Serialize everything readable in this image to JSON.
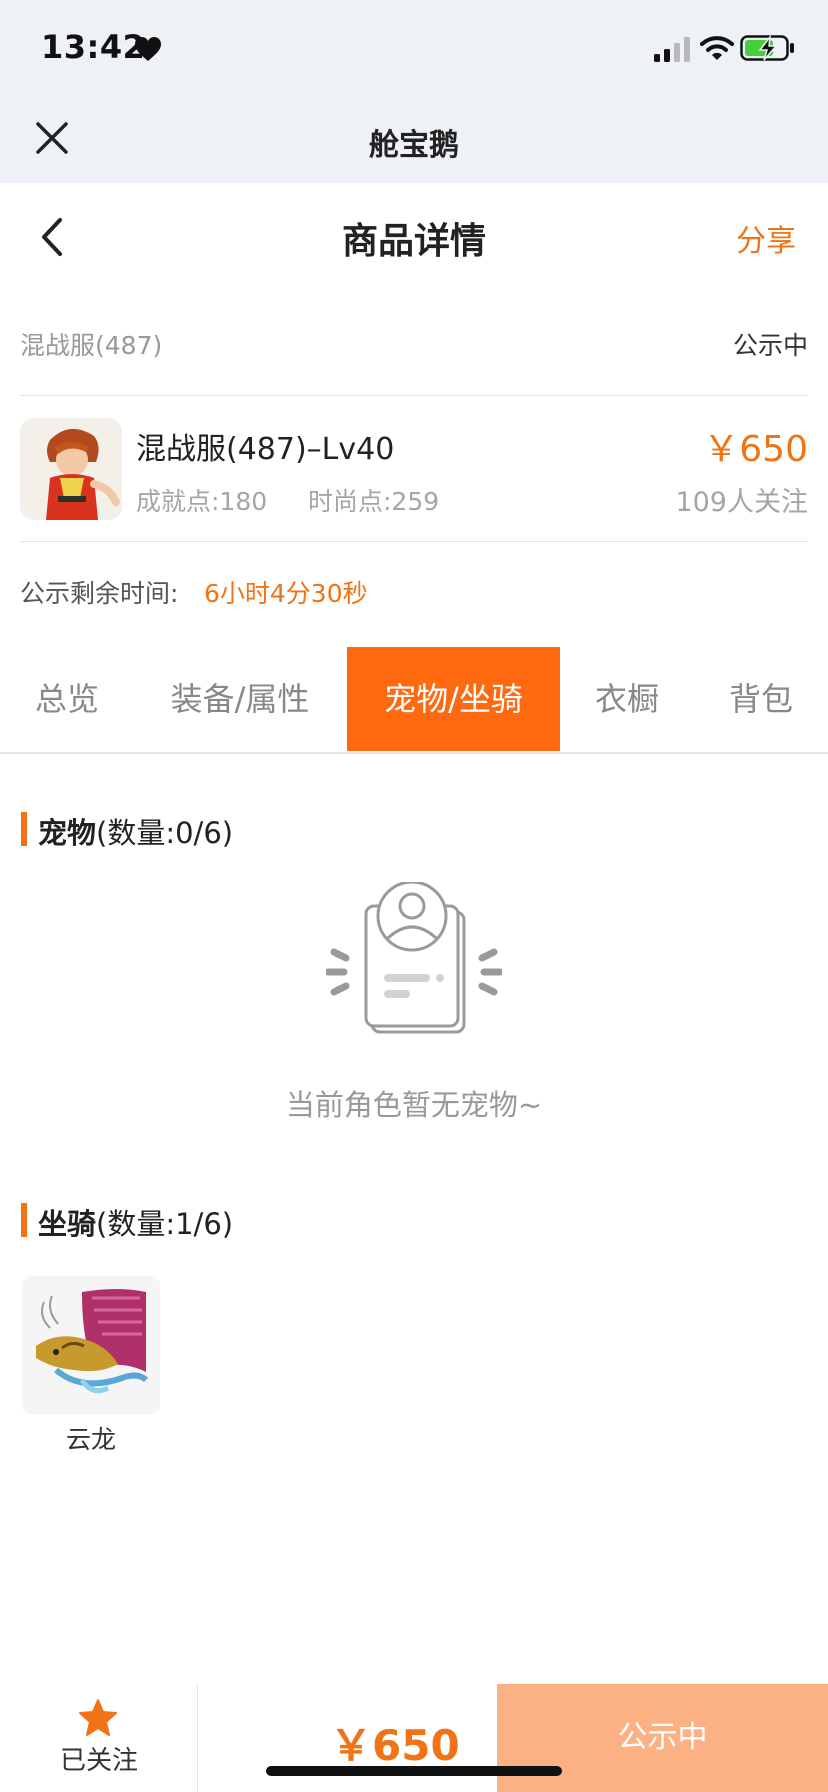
{
  "status_bar": {
    "time": "13:42"
  },
  "miniapp": {
    "title": "舱宝鹅"
  },
  "nav": {
    "title": "商品详情",
    "share": "分享"
  },
  "server": {
    "name": "混战服(487)",
    "status": "公示中"
  },
  "product": {
    "title": "混战服(487)–Lv40",
    "achievement": "成就点:180",
    "fashion": "时尚点:259",
    "price": "￥650",
    "followers": "109人关注"
  },
  "remaining": {
    "label": "公示剩余时间:",
    "value": "6小时4分30秒"
  },
  "tabs": [
    {
      "label": "总览",
      "active": false
    },
    {
      "label": "装备/属性",
      "active": false
    },
    {
      "label": "宠物/坐骑",
      "active": true
    },
    {
      "label": "衣橱",
      "active": false
    },
    {
      "label": "背包",
      "active": false
    }
  ],
  "pets": {
    "title": "宠物",
    "count": "(数量:0/6)",
    "empty_text": "当前角色暂无宠物~"
  },
  "mounts": {
    "title": "坐骑",
    "count": "(数量:1/6)",
    "items": [
      {
        "name": "云龙"
      }
    ]
  },
  "bottom": {
    "follow_label": "已关注",
    "price": "￥650",
    "status_button": "公示中"
  },
  "colors": {
    "accent": "#f07316",
    "tab_active": "#ff6a10",
    "button_disabled": "#fcb184"
  }
}
